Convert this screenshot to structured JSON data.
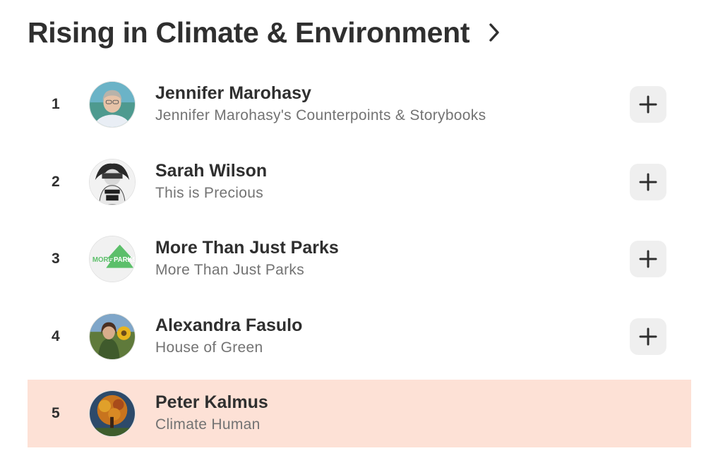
{
  "header": {
    "title": "Rising in Climate & Environment",
    "chevron_icon": "chevron-right-icon"
  },
  "items": [
    {
      "rank": "1",
      "name": "Jennifer Marohasy",
      "subtitle": "Jennifer Marohasy's Counterpoints & Storybooks",
      "action_icon": "plus-icon",
      "highlighted": false
    },
    {
      "rank": "2",
      "name": "Sarah Wilson",
      "subtitle": "This is Precious",
      "action_icon": "plus-icon",
      "highlighted": false
    },
    {
      "rank": "3",
      "name": "More Than Just Parks",
      "subtitle": "More Than Just Parks",
      "avatar_logo_text": "MORE THAN JUST PARKS",
      "action_icon": "plus-icon",
      "highlighted": false
    },
    {
      "rank": "4",
      "name": "Alexandra Fasulo",
      "subtitle": "House of Green",
      "action_icon": "plus-icon",
      "highlighted": false
    },
    {
      "rank": "5",
      "name": "Peter Kalmus",
      "subtitle": "Climate Human",
      "highlighted": true
    }
  ],
  "colors": {
    "highlight": "#fde1d6",
    "button_bg": "#efefef",
    "title": "#2f2f2f",
    "subtitle": "#737373",
    "logo_green": "#5cbf6a"
  }
}
